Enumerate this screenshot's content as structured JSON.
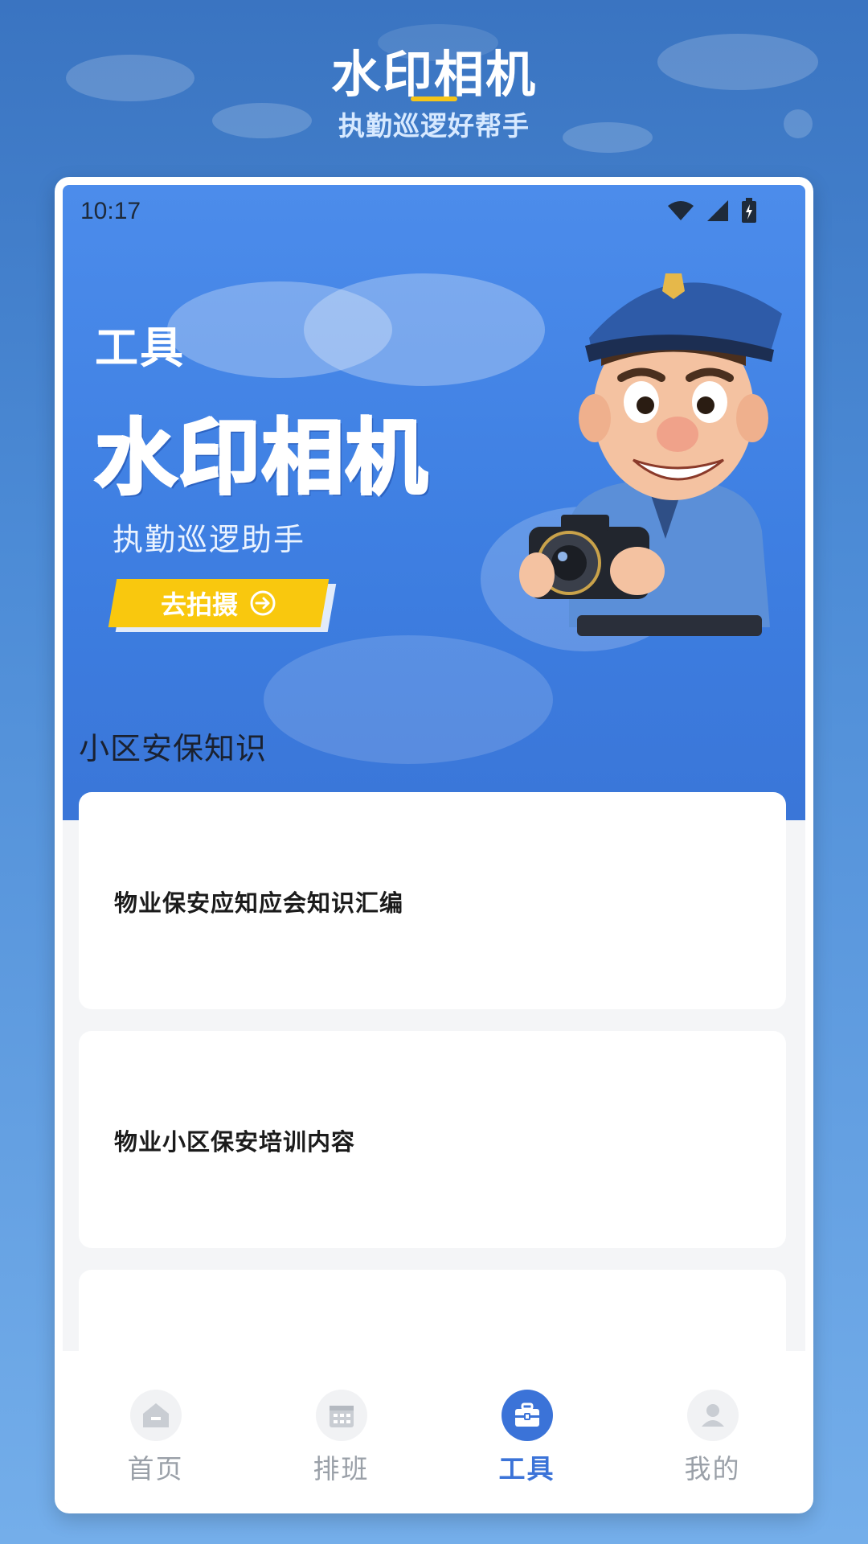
{
  "promo": {
    "title": "水印相机",
    "subtitle": "执勤巡逻好帮手"
  },
  "status_bar": {
    "time": "10:17"
  },
  "hero": {
    "section_label": "工具",
    "title": "水印相机",
    "subtitle": "执勤巡逻助手",
    "button_label": "去拍摄"
  },
  "knowledge": {
    "heading": "小区安保知识",
    "items": [
      {
        "title": "物业保安应知应会知识汇编"
      },
      {
        "title": "物业小区保安培训内容"
      },
      {
        "title": ""
      }
    ]
  },
  "tabbar": {
    "items": [
      {
        "label": "首页",
        "icon": "home-icon",
        "active": false
      },
      {
        "label": "排班",
        "icon": "calendar-icon",
        "active": false
      },
      {
        "label": "工具",
        "icon": "toolbox-icon",
        "active": true
      },
      {
        "label": "我的",
        "icon": "user-icon",
        "active": false
      }
    ]
  },
  "colors": {
    "accent": "#3B73D8",
    "button": "#F9C80E",
    "promo_underline": "#F5C518"
  }
}
